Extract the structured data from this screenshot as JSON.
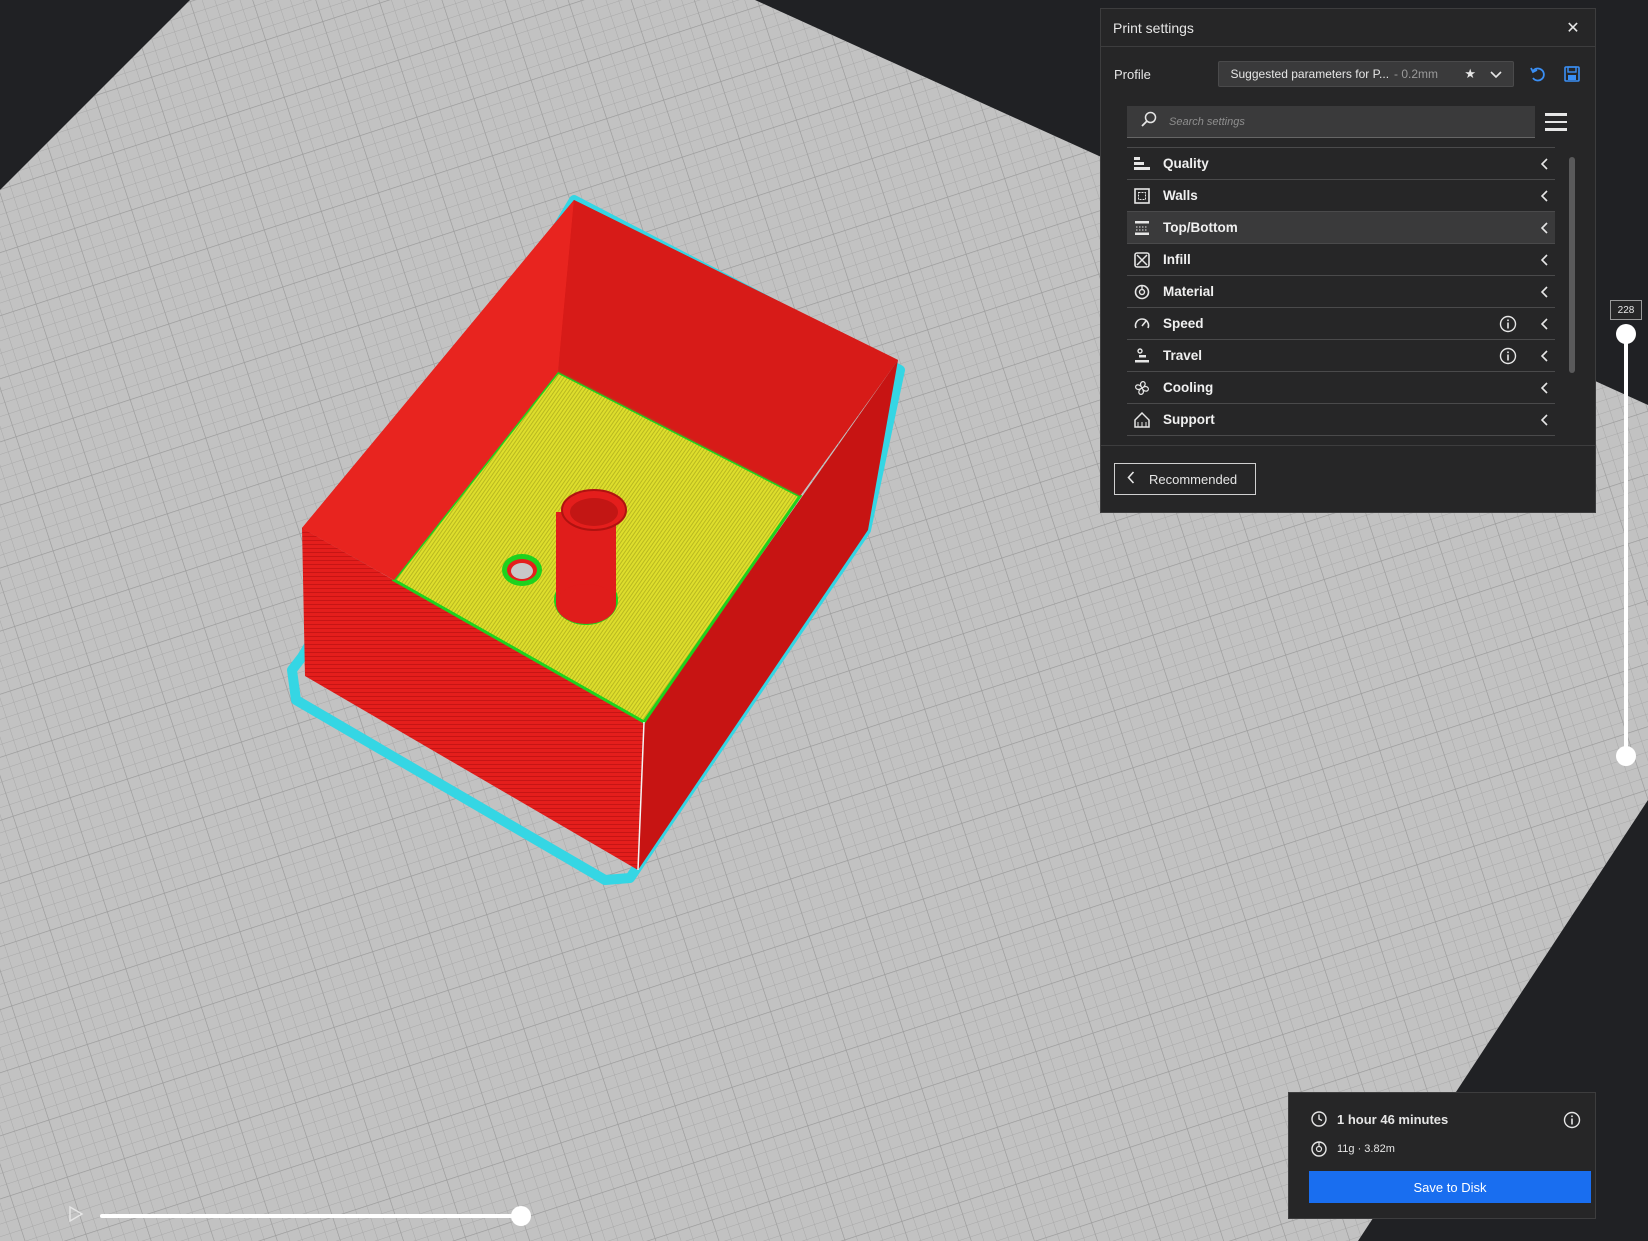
{
  "panel": {
    "title": "Print settings",
    "profile_label": "Profile",
    "profile_name": "Suggested parameters for P...",
    "profile_layer": "- 0.2mm",
    "search_placeholder": "Search settings",
    "categories": [
      {
        "label": "Quality",
        "icon": "quality-icon",
        "info": false
      },
      {
        "label": "Walls",
        "icon": "walls-icon",
        "info": false
      },
      {
        "label": "Top/Bottom",
        "icon": "top-bottom-icon",
        "info": false
      },
      {
        "label": "Infill",
        "icon": "infill-icon",
        "info": false
      },
      {
        "label": "Material",
        "icon": "material-icon",
        "info": false
      },
      {
        "label": "Speed",
        "icon": "speed-icon",
        "info": true
      },
      {
        "label": "Travel",
        "icon": "travel-icon",
        "info": true
      },
      {
        "label": "Cooling",
        "icon": "cooling-icon",
        "info": false
      },
      {
        "label": "Support",
        "icon": "support-icon",
        "info": false
      }
    ],
    "recommended_label": "Recommended"
  },
  "layer_slider": {
    "value": "228"
  },
  "print_info": {
    "time": "1 hour 46 minutes",
    "material": "11g · 3.82m",
    "save_label": "Save to Disk"
  },
  "colors": {
    "accent": "#196ef0",
    "wall": "#e8201e",
    "top_skin": "#e3e32a",
    "inner_wall": "#1ed21e",
    "skirt": "#36d8e6",
    "build_plate": "#bdbdbd",
    "background": "#202124"
  }
}
